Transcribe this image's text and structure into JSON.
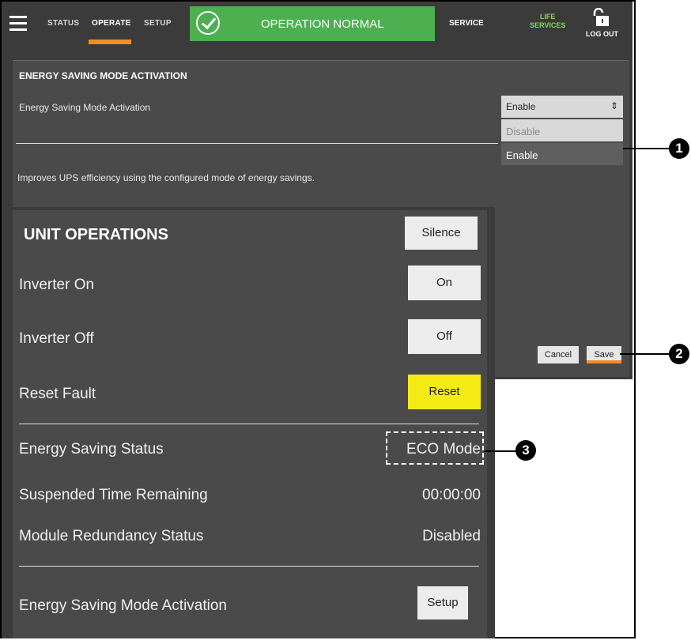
{
  "topbar": {
    "nav": {
      "status": "STATUS",
      "operate": "OPERATE",
      "setup": "SETUP"
    },
    "operation_status": "OPERATION NORMAL",
    "service": "SERVICE",
    "life_services_1": "LIFE",
    "life_services_2": "SERVICES",
    "logout": "LOG OUT"
  },
  "energy_panel": {
    "title": "ENERGY SAVING MODE ACTIVATION",
    "label": "Energy Saving Mode Activation",
    "select_value": "Enable",
    "options": [
      "Disable",
      "Enable"
    ],
    "description": "Improves UPS efficiency using the configured mode of energy savings.",
    "cancel": "Cancel",
    "save": "Save"
  },
  "unit_operations": {
    "title": "UNIT OPERATIONS",
    "silence": "Silence",
    "inverter_on_label": "Inverter On",
    "inverter_on_btn": "On",
    "inverter_off_label": "Inverter Off",
    "inverter_off_btn": "Off",
    "reset_label": "Reset Fault",
    "reset_btn": "Reset",
    "energy_status_label": "Energy Saving Status",
    "energy_status_value": "ECO Mode",
    "suspended_label": "Suspended Time Remaining",
    "suspended_value": "00:00:00",
    "redundancy_label": "Module Redundancy Status",
    "redundancy_value": "Disabled",
    "activation_label": "Energy Saving Mode Activation",
    "setup_btn": "Setup"
  },
  "callouts": [
    "1",
    "2",
    "3"
  ],
  "colors": {
    "accent": "#f28c28",
    "status_green": "#4caf50",
    "reset_yellow": "#f5eb14",
    "panel": "#4a4a4a"
  }
}
